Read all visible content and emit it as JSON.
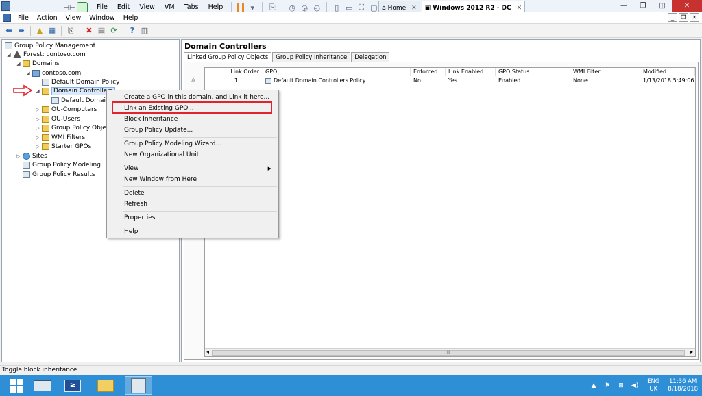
{
  "vmware": {
    "menu": [
      "File",
      "Edit",
      "View",
      "VM",
      "Tabs",
      "Help"
    ],
    "tabs": [
      {
        "label": "Home",
        "active": false
      },
      {
        "label": "Windows 2012 R2 - DC",
        "active": true
      }
    ]
  },
  "mmc": {
    "menu": [
      "File",
      "Action",
      "View",
      "Window",
      "Help"
    ]
  },
  "tree": {
    "root": "Group Policy Management",
    "forest": "Forest: contoso.com",
    "domains": "Domains",
    "domain": "contoso.com",
    "default_domain_policy": "Default Domain Policy",
    "domain_controllers": "Domain Controllers",
    "dc_child": "Default Domain",
    "ou_computers": "OU-Computers",
    "ou_users": "OU-Users",
    "gpo_objects": "Group Policy Objec",
    "wmi_filters": "WMI Filters",
    "starter_gpos": "Starter GPOs",
    "sites": "Sites",
    "modeling": "Group Policy Modeling",
    "results": "Group Policy Results"
  },
  "context_menu": {
    "items": [
      "Create a GPO in this domain, and Link it here...",
      "Link an Existing GPO...",
      "Block Inheritance",
      "Group Policy Update...",
      "Group Policy Modeling Wizard...",
      "New Organizational Unit",
      "View",
      "New Window from Here",
      "Delete",
      "Refresh",
      "Properties",
      "Help"
    ],
    "highlighted": "Link an Existing GPO..."
  },
  "right_pane": {
    "title": "Domain Controllers",
    "tabs": [
      "Linked Group Policy Objects",
      "Group Policy Inheritance",
      "Delegation"
    ],
    "columns": [
      "Link Order",
      "GPO",
      "Enforced",
      "Link Enabled",
      "GPO Status",
      "WMI Filter",
      "Modified"
    ],
    "rows": [
      {
        "link_order": "1",
        "gpo": "Default Domain Controllers Policy",
        "enforced": "No",
        "link_enabled": "Yes",
        "gpo_status": "Enabled",
        "wmi_filter": "None",
        "modified": "1/13/2018 5:49:06 P"
      }
    ],
    "scroll_grip": "III"
  },
  "status": "Toggle block inheritance",
  "taskbar": {
    "lang_top": "ENG",
    "lang_bottom": "UK",
    "time": "11:36 AM",
    "date": "8/18/2018"
  },
  "colors": {
    "highlight_box": "#e2232b",
    "taskbar": "#2e8fd6",
    "close_button": "#c7312f"
  }
}
